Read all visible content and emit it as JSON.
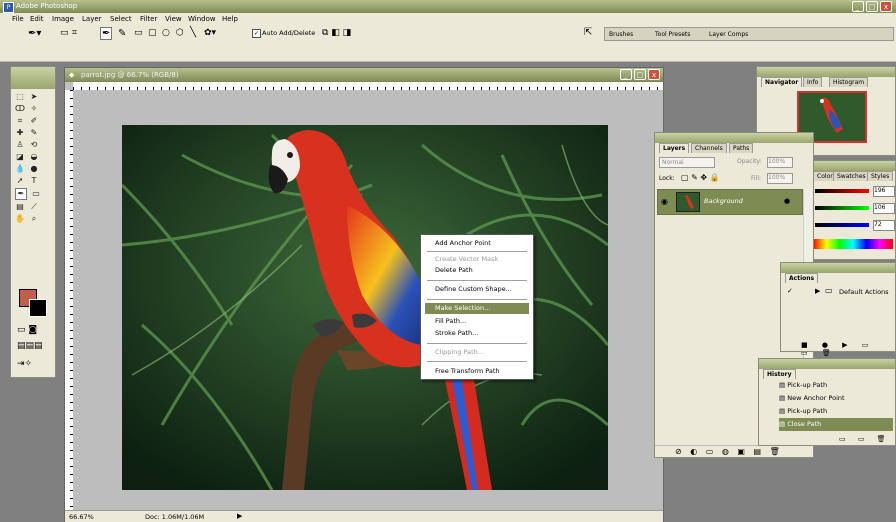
{
  "app": {
    "title": "Adobe Photoshop"
  },
  "menubar": [
    "File",
    "Edit",
    "Image",
    "Layer",
    "Select",
    "Filter",
    "View",
    "Window",
    "Help"
  ],
  "options_bar": {
    "auto_add_delete": "Auto Add/Delete"
  },
  "palette_well": {
    "tabs": [
      "Brushes",
      "Tool Presets",
      "Layer Comps"
    ]
  },
  "document": {
    "title": "parrot.jpg @ 66.7% (RGB/8)",
    "zoom": "66.67%",
    "doc_info": "Doc: 1.06M/1.06M"
  },
  "context_menu": {
    "items": [
      {
        "label": "Add Anchor Point",
        "enabled": true,
        "highlighted": false
      },
      {
        "label": "Create Vector Mask",
        "enabled": false,
        "highlighted": false
      },
      {
        "label": "Delete Path",
        "enabled": true,
        "highlighted": false
      },
      {
        "label": "Define Custom Shape...",
        "enabled": true,
        "highlighted": false
      },
      {
        "label": "Make Selection...",
        "enabled": true,
        "highlighted": true
      },
      {
        "label": "Fill Path...",
        "enabled": true,
        "highlighted": false
      },
      {
        "label": "Stroke Path...",
        "enabled": true,
        "highlighted": false
      },
      {
        "label": "Clipping Path...",
        "enabled": false,
        "highlighted": false
      },
      {
        "label": "Free Transform Path",
        "enabled": true,
        "highlighted": false
      }
    ]
  },
  "navigator": {
    "tabs": [
      "Navigator",
      "Info",
      "Histogram"
    ]
  },
  "layers": {
    "tabs": [
      "Layers",
      "Channels",
      "Paths"
    ],
    "blend_mode": "Normal",
    "opacity_label": "Opacity:",
    "opacity": "100%",
    "lock_label": "Lock:",
    "fill_label": "Fill:",
    "fill": "100%",
    "layer_name": "Background"
  },
  "color": {
    "tabs": [
      "Color",
      "Swatches",
      "Styles"
    ],
    "values": [
      "196",
      "106",
      "72"
    ]
  },
  "actions": {
    "tabs": [
      "Actions"
    ],
    "set_name": "Default Actions"
  },
  "history": {
    "tabs": [
      "History"
    ],
    "items": [
      "Pick-up Path",
      "New Anchor Point",
      "Pick-up Path",
      "Close Path"
    ]
  },
  "colors": {
    "accent": "#7e8b53",
    "foreground_swatch": "#c0604a",
    "menu_highlight": "#7e8b53"
  }
}
